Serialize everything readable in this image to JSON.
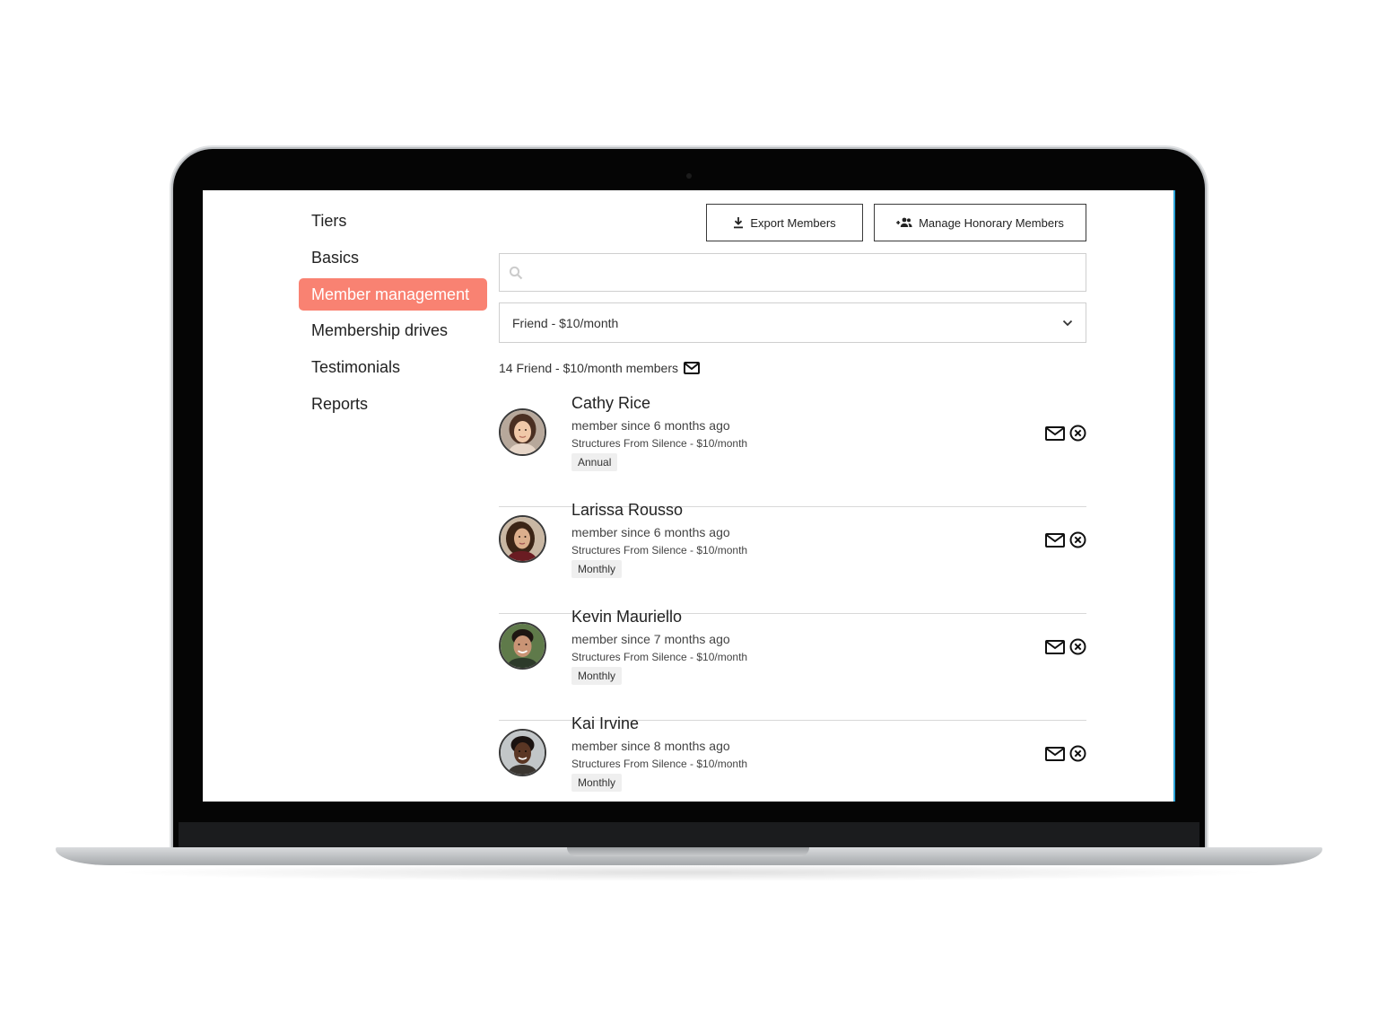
{
  "sidebar": {
    "items": [
      {
        "label": "Tiers"
      },
      {
        "label": "Basics"
      },
      {
        "label": "Member management"
      },
      {
        "label": "Membership drives"
      },
      {
        "label": "Testimonials"
      },
      {
        "label": "Reports"
      }
    ]
  },
  "toolbar": {
    "export_label": "Export Members",
    "honorary_label": "Manage Honorary Members"
  },
  "search": {
    "placeholder": "",
    "value": ""
  },
  "filter": {
    "selected": "Friend - $10/month"
  },
  "summary": {
    "count_text": "14 Friend - $10/month members"
  },
  "members": [
    {
      "name": "Cathy Rice",
      "since": "member since 6 months ago",
      "tier": "Structures From Silence - $10/month",
      "billing": "Annual"
    },
    {
      "name": "Larissa Rousso",
      "since": "member since 6 months ago",
      "tier": "Structures From Silence - $10/month",
      "billing": "Monthly"
    },
    {
      "name": "Kevin Mauriello",
      "since": "member since 7 months ago",
      "tier": "Structures From Silence - $10/month",
      "billing": "Monthly"
    },
    {
      "name": "Kai Irvine",
      "since": "member since 8 months ago",
      "tier": "Structures From Silence - $10/month",
      "billing": "Monthly"
    }
  ],
  "colors": {
    "accent": "#f98272",
    "text": "#222222",
    "border": "#cfcfcf"
  },
  "icons": [
    "download-icon",
    "add-people-icon",
    "search-icon",
    "chevron-down-icon",
    "mail-icon",
    "remove-circle-icon"
  ]
}
